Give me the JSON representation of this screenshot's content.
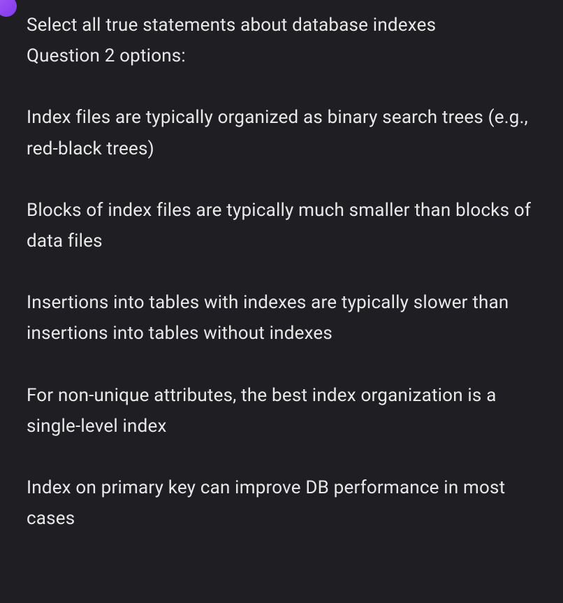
{
  "question": {
    "prompt": "Select all true statements about database indexes",
    "label": "Question 2 options:"
  },
  "options": [
    "Index files are typically organized as binary search trees (e.g., red-black trees)",
    "Blocks of index files are typically much smaller than blocks of data files",
    "Insertions into tables with indexes are typically slower than insertions into tables without indexes",
    "For non-unique attributes, the best index organization is a single-level index",
    "Index on primary key can improve DB performance in most cases"
  ]
}
